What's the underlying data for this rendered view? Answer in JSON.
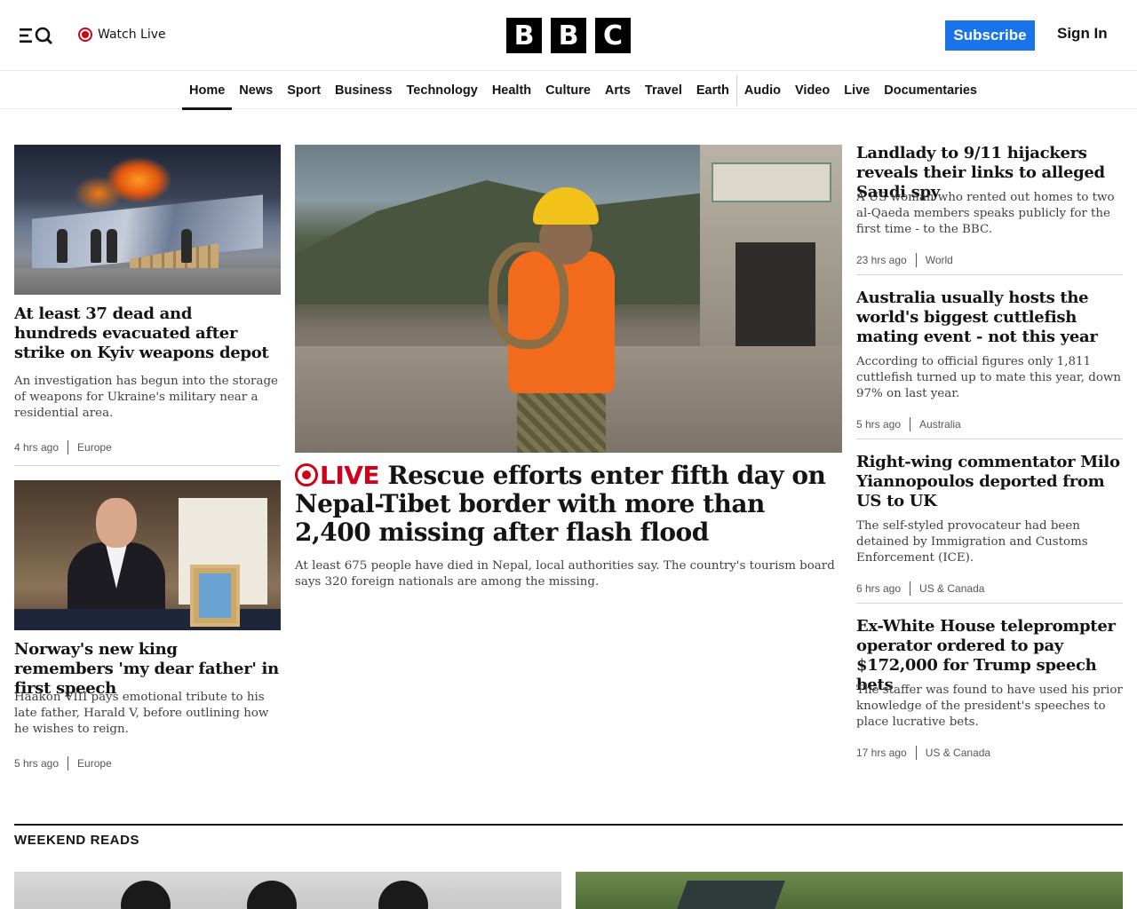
{
  "header": {
    "watch_live": "Watch Live",
    "logo_letters": [
      "B",
      "B",
      "C"
    ],
    "subscribe": "Subscribe",
    "sign_in": "Sign In"
  },
  "nav": {
    "items": [
      "Home",
      "News",
      "Sport",
      "Business",
      "Technology",
      "Health",
      "Culture",
      "Arts",
      "Travel",
      "Earth",
      "Audio",
      "Video",
      "Live",
      "Documentaries"
    ],
    "active": "Home"
  },
  "left_stories": [
    {
      "headline": "At least 37 dead and hundreds evacuated after strike on Kyiv weapons depot",
      "summary": "An investigation has begun into the storage of weapons for Ukraine's military near a residential area.",
      "time": "4 hrs ago",
      "category": "Europe"
    },
    {
      "headline": "Norway's new king remembers 'my dear father' in first speech",
      "summary": "Haakon VIII pays emotional tribute to his late father, Harald V, before outlining how he wishes to reign.",
      "time": "5 hrs ago",
      "category": "Europe"
    }
  ],
  "main_story": {
    "live_label": "LIVE",
    "headline": "Rescue efforts enter fifth day on Nepal-Tibet border with more than 2,400 missing after flash flood",
    "summary": "At least 675 people have died in Nepal, local authorities say. The country's tourism board says 320 foreign nationals are among the missing."
  },
  "right_stories": [
    {
      "headline": "Landlady to 9/11 hijackers reveals their links to alleged Saudi spy",
      "summary": "A US woman who rented out homes to two al-Qaeda members speaks publicly for the first time - to the BBC.",
      "time": "23 hrs ago",
      "category": "World"
    },
    {
      "headline": "Australia usually hosts the world's biggest cuttlefish mating event - not this year",
      "summary": "According to official figures only 1,811 cuttlefish turned up to mate this year, down 97% on last year.",
      "time": "5 hrs ago",
      "category": "Australia"
    },
    {
      "headline": "Right-wing commentator Milo Yiannopoulos deported from US to UK",
      "summary": "The self-styled provocateur had been detained by Immigration and Customs Enforcement (ICE).",
      "time": "6 hrs ago",
      "category": "US & Canada"
    },
    {
      "headline": "Ex-White House teleprompter operator ordered to pay $172,000 for Trump speech bets",
      "summary": "The staffer was found to have used his prior knowledge of the president's speeches to place lucrative bets.",
      "time": "17 hrs ago",
      "category": "US & Canada"
    }
  ],
  "weekend_reads": {
    "title": "WEEKEND READS"
  },
  "colors": {
    "live_red": "#d0021b",
    "subscribe_blue": "#1a73e8",
    "text": "#141414"
  },
  "icons": [
    "menu-search-icon",
    "live-indicator-icon"
  ]
}
